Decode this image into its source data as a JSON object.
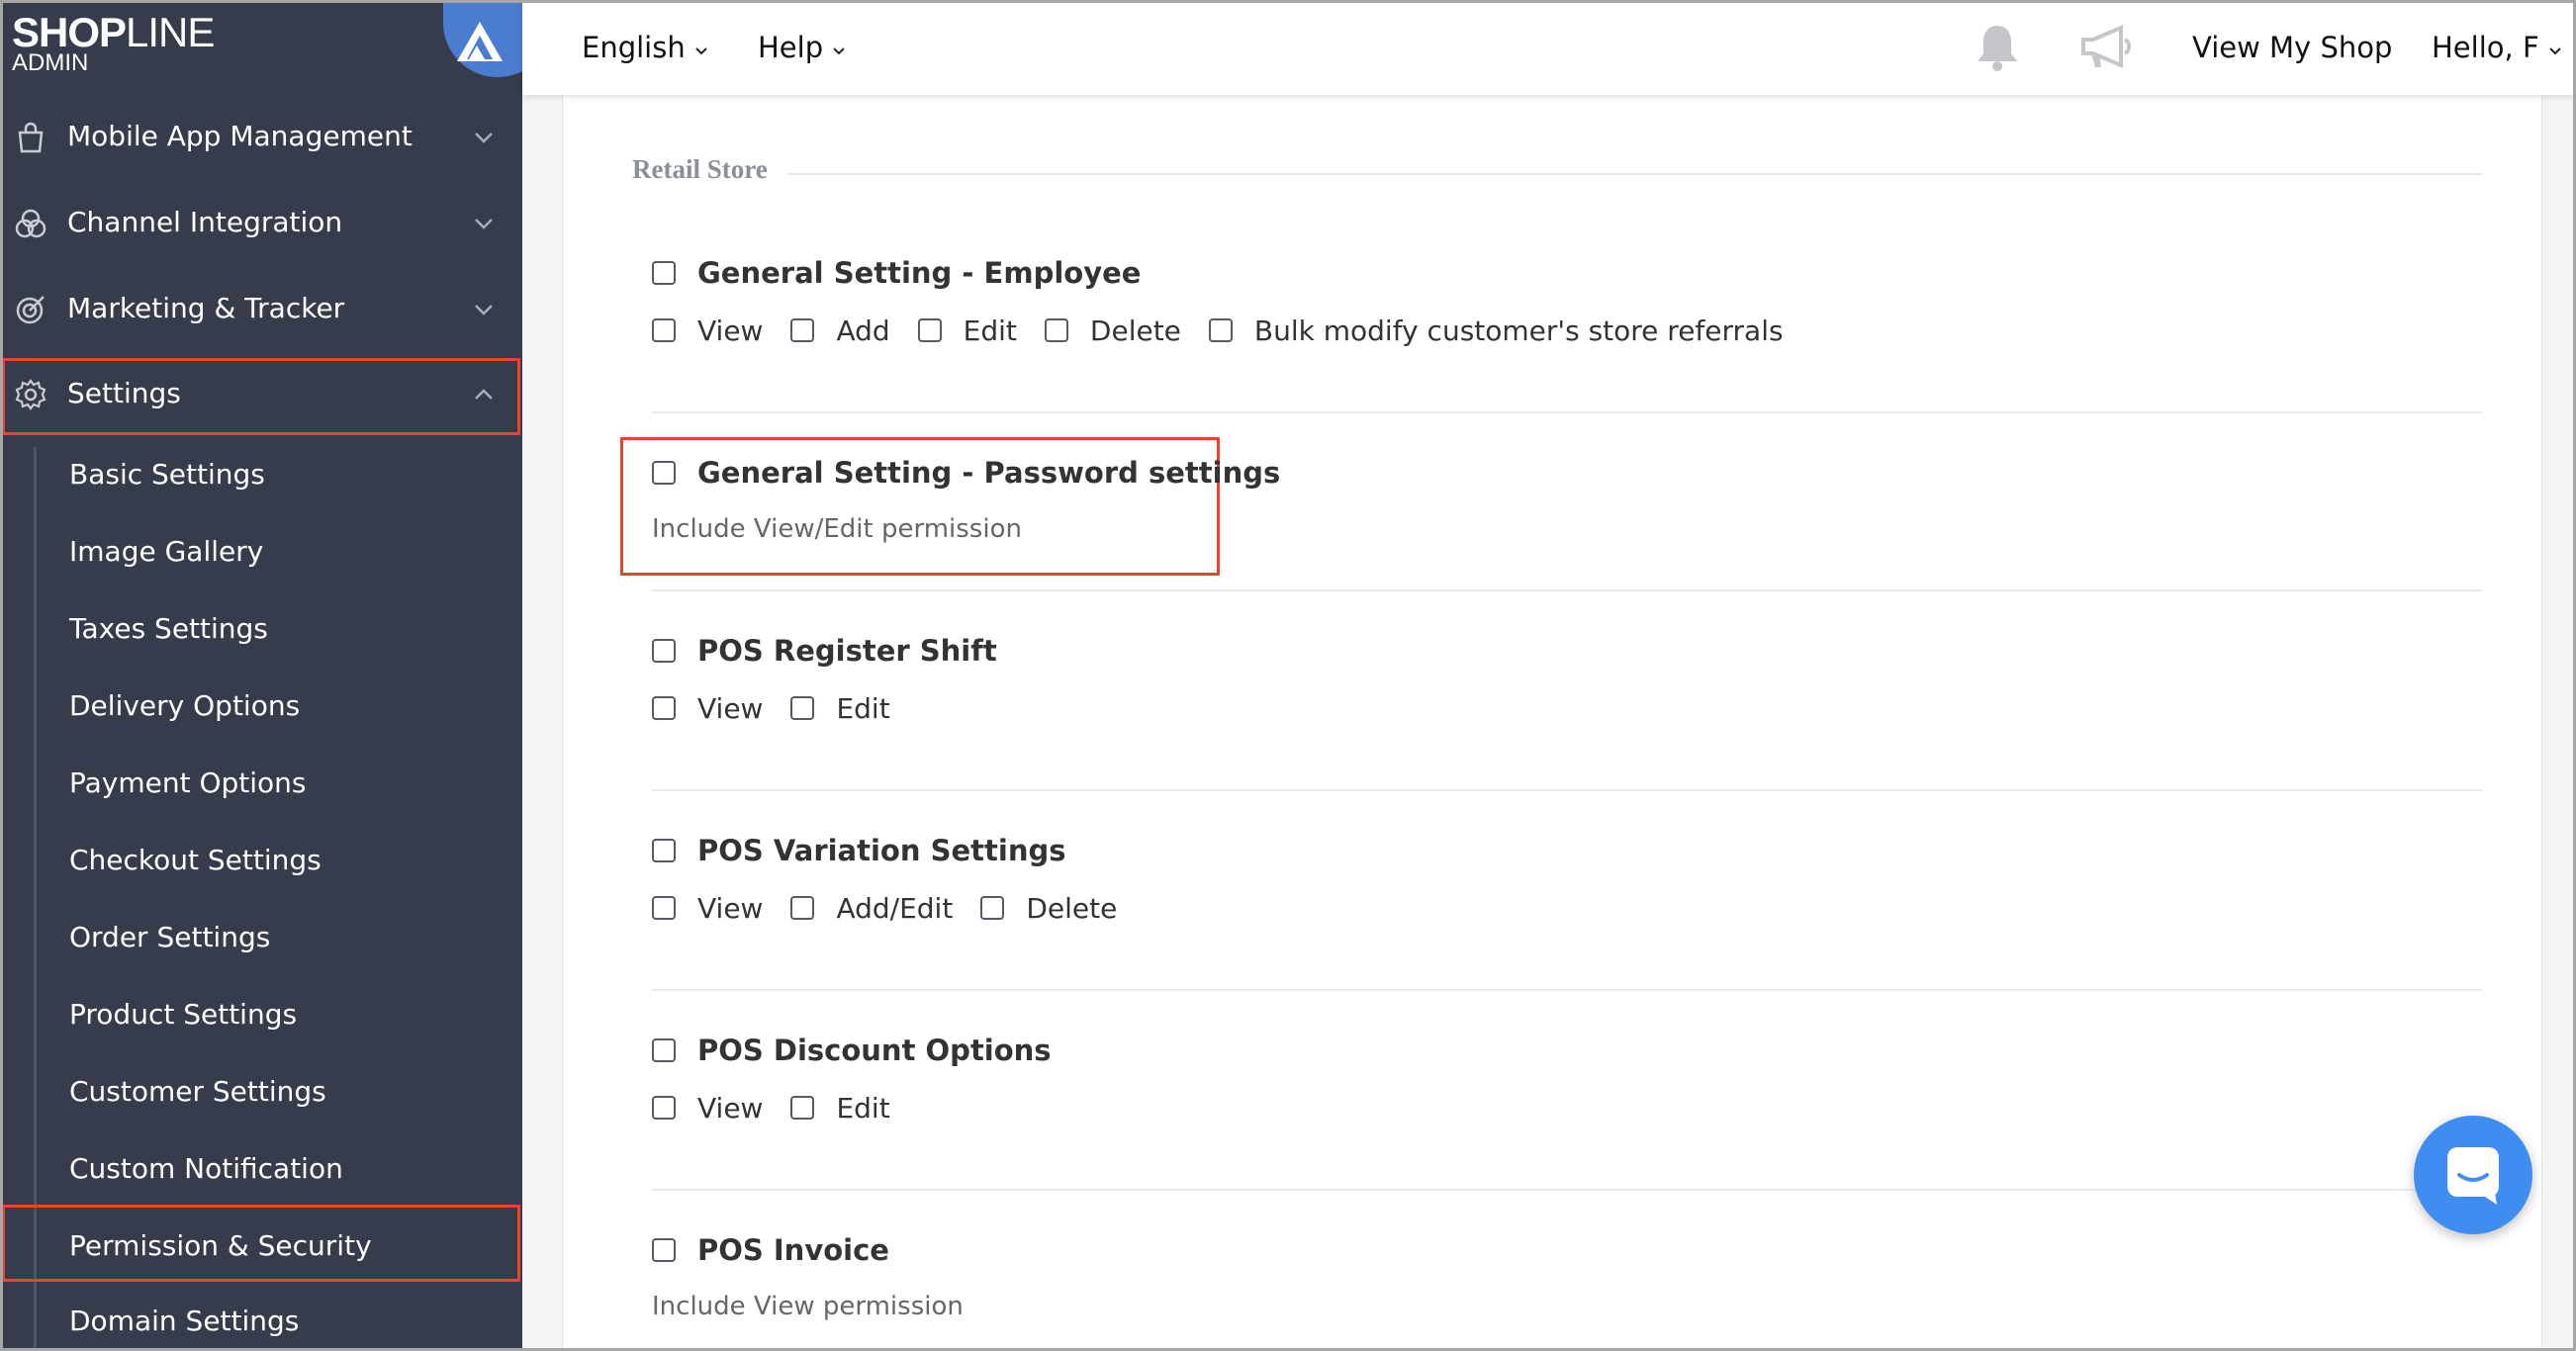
{
  "brand": {
    "logo_main": "SHOP",
    "logo_light": "LINE",
    "logo_sub": "ADMIN"
  },
  "sidebar": {
    "items": [
      {
        "label": "Mobile App Management",
        "icon": "shopping-bag-icon"
      },
      {
        "label": "Channel Integration",
        "icon": "channels-icon"
      },
      {
        "label": "Marketing & Tracker",
        "icon": "target-icon"
      },
      {
        "label": "Settings",
        "icon": "gear-icon",
        "expanded": true
      }
    ],
    "settings_sub": [
      "Basic Settings",
      "Image Gallery",
      "Taxes Settings",
      "Delivery Options",
      "Payment Options",
      "Checkout Settings",
      "Order Settings",
      "Product Settings",
      "Customer Settings",
      "Custom Notification",
      "Permission & Security",
      "Domain Settings"
    ]
  },
  "topbar": {
    "language": "English",
    "help": "Help",
    "view_shop": "View My Shop",
    "greeting": "Hello, F"
  },
  "section": {
    "title": "Retail Store"
  },
  "permissions": [
    {
      "title": "General Setting - Employee",
      "options": [
        "View",
        "Add",
        "Edit",
        "Delete",
        "Bulk modify customer's store referrals"
      ]
    },
    {
      "title": "General Setting - Password settings",
      "description": "Include View/Edit permission"
    },
    {
      "title": "POS Register Shift",
      "options": [
        "View",
        "Edit"
      ]
    },
    {
      "title": "POS Variation Settings",
      "options": [
        "View",
        "Add/Edit",
        "Delete"
      ]
    },
    {
      "title": "POS Discount Options",
      "options": [
        "View",
        "Edit"
      ]
    },
    {
      "title": "POS Invoice",
      "description": "Include View permission"
    }
  ],
  "colors": {
    "sidebar_bg": "#363c4c",
    "highlight": "#e5462f",
    "accent": "#3f8df0"
  }
}
